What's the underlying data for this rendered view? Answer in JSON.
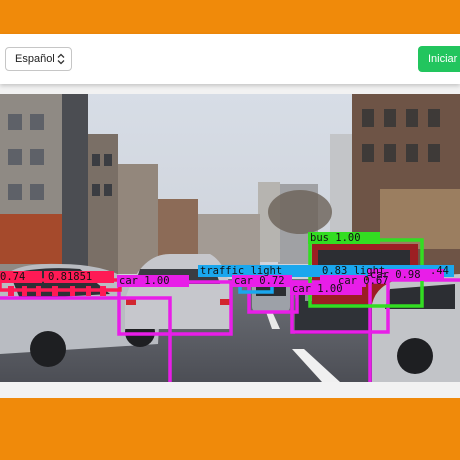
{
  "toolbar": {
    "language_select": {
      "value": "Español"
    },
    "start_button": {
      "label": "Iniciar V"
    }
  },
  "colors": {
    "frame_background": "#f08a0a",
    "start_button": "#22c55e",
    "box_person_car": "#e81ee8",
    "box_bus": "#33dd22",
    "box_traffic_light": "#1aa7ee",
    "box_red": "#ff1a55"
  },
  "detections": [
    {
      "label": "car 1.00",
      "color": "magenta"
    },
    {
      "label": "car 0.72",
      "color": "magenta"
    },
    {
      "label": "car 0.67",
      "color": "magenta"
    },
    {
      "label": "car 1.00",
      "color": "magenta"
    },
    {
      "label": "car 0.98",
      "color": "magenta"
    },
    {
      "label": "bus 1.00",
      "color": "green"
    },
    {
      "label": "traffic light",
      "color": "blue"
    },
    {
      "label": "0.83 light",
      "color": "blue"
    },
    {
      "label": ".44",
      "color": "blue"
    },
    {
      "label": "0.74",
      "color": "red"
    },
    {
      "label": "0.81851",
      "color": "red"
    }
  ]
}
